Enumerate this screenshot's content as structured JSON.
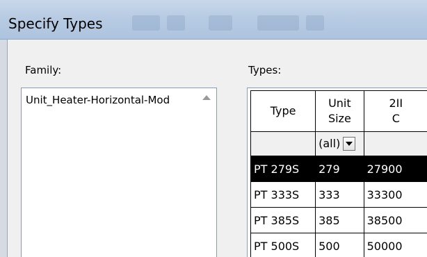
{
  "window": {
    "title": "Specify Types"
  },
  "family": {
    "label": "Family:",
    "items": [
      "Unit_Heater-Horizontal-Mod"
    ]
  },
  "types": {
    "label": "Types:",
    "columns": [
      "Type",
      "Unit Size",
      "2II C"
    ],
    "filter": {
      "unit_size": "(all)"
    },
    "rows": [
      {
        "type": "PT 279S",
        "unit_size": "279",
        "col3": "27900",
        "selected": true
      },
      {
        "type": "PT 333S",
        "unit_size": "333",
        "col3": "33300",
        "selected": false
      },
      {
        "type": "PT 385S",
        "unit_size": "385",
        "col3": "38500",
        "selected": false
      },
      {
        "type": "PT 500S",
        "unit_size": "500",
        "col3": "50000",
        "selected": false
      }
    ]
  },
  "colors": {
    "selection": "#000000",
    "title_bar": "#b7cbe3"
  }
}
